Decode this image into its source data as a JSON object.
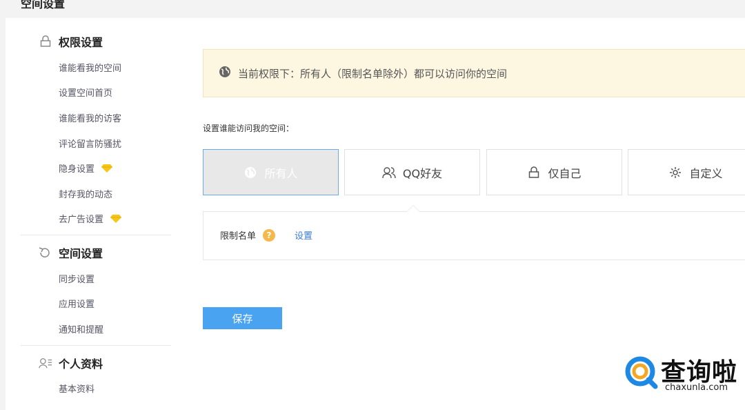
{
  "page": {
    "title": "空间设置"
  },
  "sidebar": {
    "sections": [
      {
        "icon": "lock-icon",
        "label": "权限设置"
      },
      {
        "icon": "refresh-icon",
        "label": "空间设置"
      },
      {
        "icon": "profile-icon",
        "label": "个人资料"
      }
    ],
    "permission_items": [
      "谁能看我的空间",
      "设置空间首页",
      "谁能看我的访客",
      "评论留言防骚扰",
      "隐身设置",
      "封存我的动态",
      "去广告设置"
    ],
    "space_items": [
      "同步设置",
      "应用设置",
      "通知和提醒"
    ],
    "profile_items": [
      "基本资料",
      "..."
    ]
  },
  "notice": {
    "icon": "globe-icon",
    "text": "当前权限下：所有人（限制名单除外）都可以访问你的空间"
  },
  "access": {
    "label": "设置谁能访问我的空间：",
    "options": [
      {
        "label": "所有人",
        "icon": "globe-icon",
        "selected": true
      },
      {
        "label": "QQ好友",
        "icon": "friends-icon",
        "selected": false
      },
      {
        "label": "仅自己",
        "icon": "lock-icon",
        "selected": false
      },
      {
        "label": "自定义",
        "icon": "gear-icon",
        "selected": false
      }
    ]
  },
  "restrict": {
    "label": "限制名单",
    "help": "?",
    "link": "设置"
  },
  "save_label": "保存",
  "watermark": {
    "brand": "查询啦",
    "domain": "chaxunla.com"
  },
  "colors": {
    "accent": "#4aa3f0",
    "notice_bg": "#fdf6e1",
    "diamond": "#f5c518",
    "link": "#3b7bd5"
  }
}
